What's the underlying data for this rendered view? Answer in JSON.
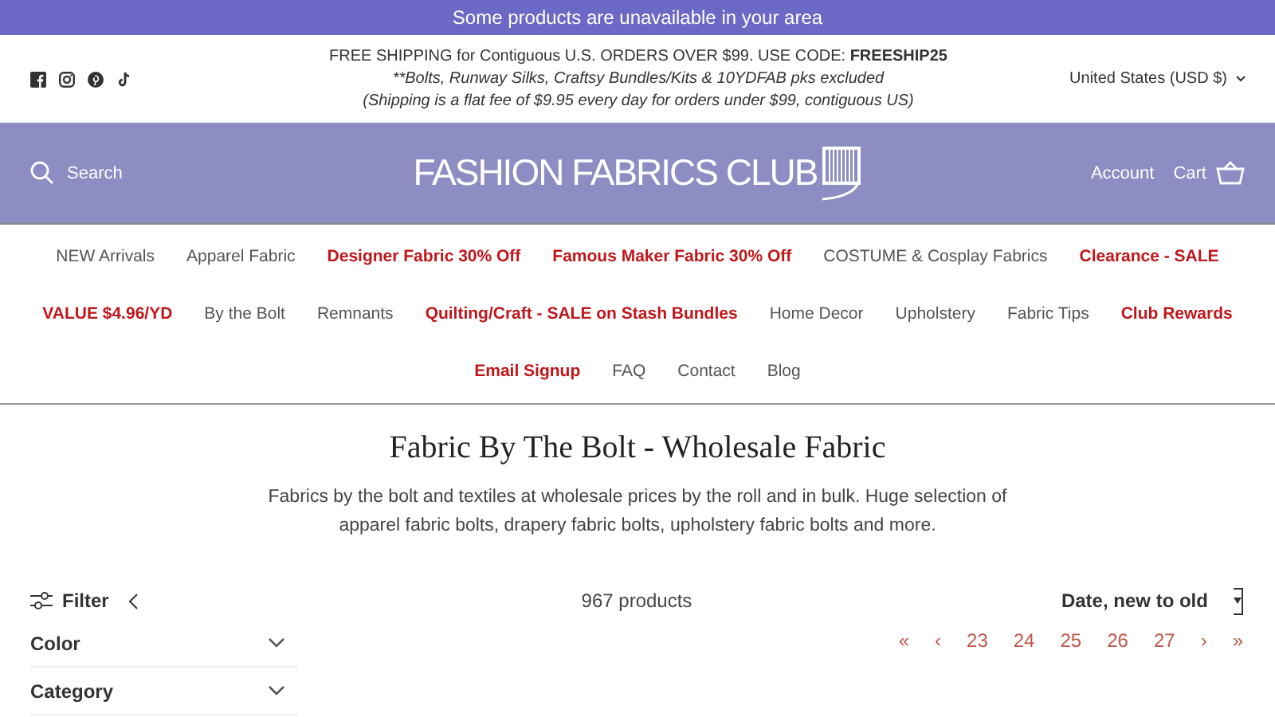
{
  "announcement": "Some products are unavailable in your area",
  "shipping": {
    "line1": "FREE SHIPPING for Contiguous U.S. ORDERS OVER $99. USE CODE: **FREESHIP25**",
    "line2": "**Bolts, Runway Silks, Craftsy Bundles/Kits & 10YDFAB pks excluded",
    "line3": "(Shipping is a flat fee of $9.95 every day for orders under $99, contiguous US)"
  },
  "country": "United States (USD $)",
  "header": {
    "search": "Search",
    "logo": "FASHION FABRICS CLUB",
    "account": "Account",
    "cart": "Cart"
  },
  "nav": [
    [
      {
        "label": "NEW Arrivals",
        "highlighted": false
      },
      {
        "label": "Apparel Fabric",
        "highlighted": false
      },
      {
        "label": "Designer Fabric 30% Off",
        "highlighted": true
      },
      {
        "label": "Famous Maker Fabric 30% Off",
        "highlighted": true
      },
      {
        "label": "COSTUME & Cosplay Fabrics",
        "highlighted": false
      },
      {
        "label": "Clearance - SALE",
        "highlighted": true
      }
    ],
    [
      {
        "label": "VALUE $4.96/YD",
        "highlighted": true
      },
      {
        "label": "By the Bolt",
        "highlighted": false
      },
      {
        "label": "Remnants",
        "highlighted": false
      },
      {
        "label": "Quilting/Craft - SALE on Stash Bundles",
        "highlighted": true
      },
      {
        "label": "Home Decor",
        "highlighted": false
      },
      {
        "label": "Upholstery",
        "highlighted": false
      },
      {
        "label": "Fabric Tips",
        "highlighted": false
      },
      {
        "label": "Club Rewards",
        "highlighted": true
      }
    ],
    [
      {
        "label": "Email Signup",
        "highlighted": true
      },
      {
        "label": "FAQ",
        "highlighted": false
      },
      {
        "label": "Contact",
        "highlighted": false
      },
      {
        "label": "Blog",
        "highlighted": false
      }
    ]
  ],
  "page_title": "Fabric By The Bolt - Wholesale Fabric",
  "description": "Fabrics by the bolt and textiles at wholesale prices by the roll and in bulk. Huge selection of apparel fabric bolts, drapery fabric bolts, upholstery fabric bolts and more.",
  "filter": "Filter",
  "product_count": "967 products",
  "sort": "Date, new to old",
  "filters": [
    {
      "label": "Color",
      "expanded": false
    },
    {
      "label": "Category",
      "expanded": false
    }
  ],
  "pagination": [
    "«",
    "‹",
    "23",
    "24",
    "25",
    "26",
    "27",
    "›",
    "»"
  ]
}
